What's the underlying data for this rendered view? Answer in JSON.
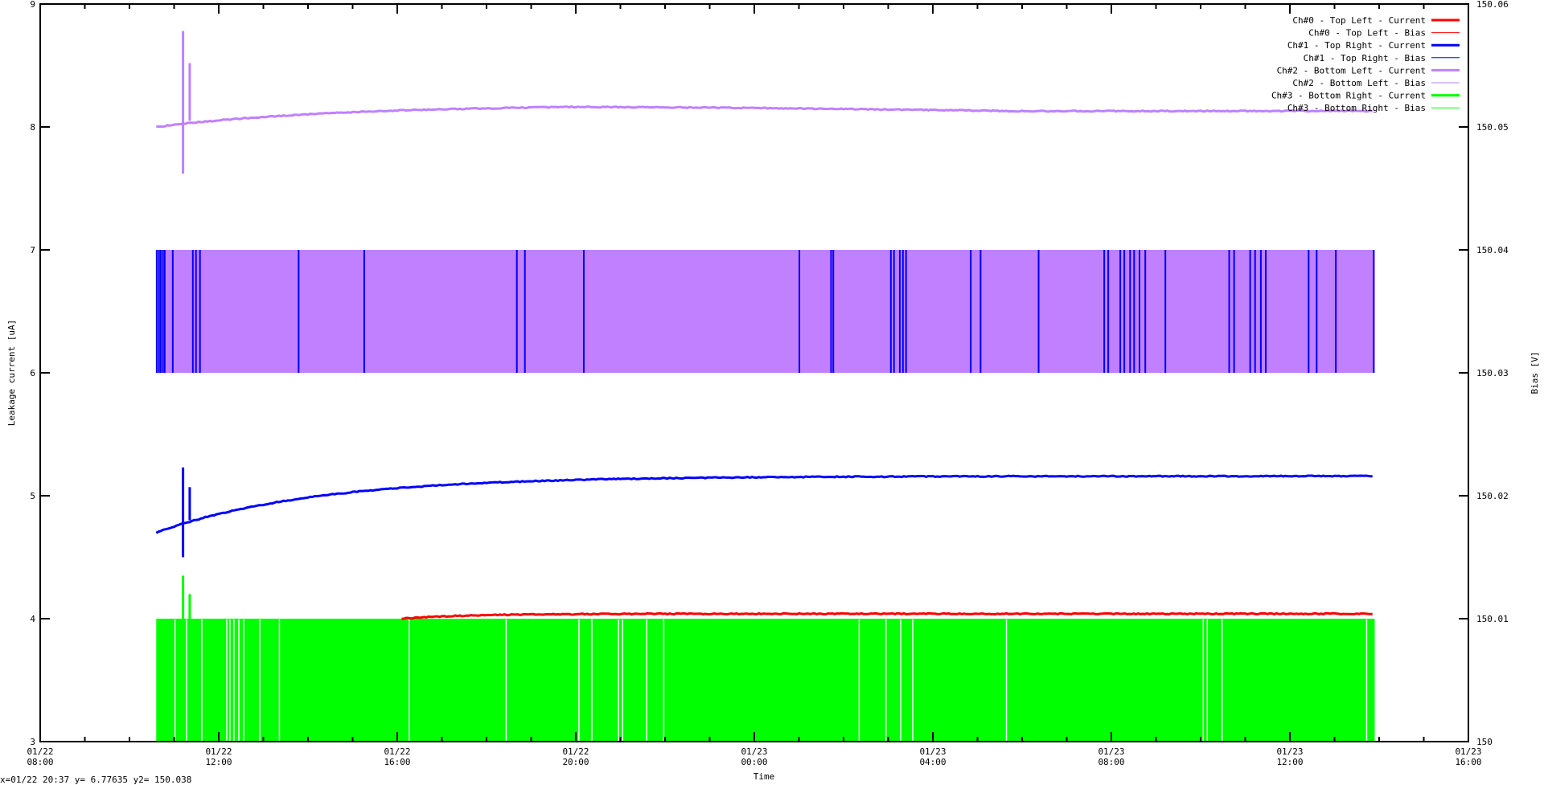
{
  "chart_data": {
    "type": "line",
    "title": "",
    "xlabel": "Time",
    "ylabel": "Leakage current [uA]",
    "y2label": "Bias [V]",
    "x_unit": "hours since 01/22 08:00",
    "xlim": [
      0,
      32
    ],
    "ylim": [
      3,
      9
    ],
    "y2lim": [
      150,
      150.06
    ],
    "grid": false,
    "legend_position": "top-right",
    "x_ticks": [
      {
        "h": 0,
        "label": [
          "01/22",
          "08:00"
        ]
      },
      {
        "h": 4,
        "label": [
          "01/22",
          "12:00"
        ]
      },
      {
        "h": 8,
        "label": [
          "01/22",
          "16:00"
        ]
      },
      {
        "h": 12,
        "label": [
          "01/22",
          "20:00"
        ]
      },
      {
        "h": 16,
        "label": [
          "01/23",
          "00:00"
        ]
      },
      {
        "h": 20,
        "label": [
          "01/23",
          "04:00"
        ]
      },
      {
        "h": 24,
        "label": [
          "01/23",
          "08:00"
        ]
      },
      {
        "h": 28,
        "label": [
          "01/23",
          "12:00"
        ]
      },
      {
        "h": 32,
        "label": [
          "01/23",
          "16:00"
        ]
      }
    ],
    "y_ticks": [
      "3",
      "4",
      "5",
      "6",
      "7",
      "8",
      "9"
    ],
    "y2_ticks": [
      "150",
      "150.01",
      "150.02",
      "150.03",
      "150.04",
      "150.05",
      "150.06"
    ],
    "data_range_hours": [
      2.6,
      29.9
    ],
    "series": [
      {
        "name": "Ch#0 - Top Left - Current",
        "color": "#ff0000",
        "axis": "y",
        "start": 8.1,
        "y0": 4.0,
        "y_end": 4.04,
        "tau": 1.5
      },
      {
        "name": "Ch#0 - Top Left - Bias",
        "color": "#ff0000",
        "axis": "y2"
      },
      {
        "name": "Ch#1 - Top Right - Current",
        "color": "#0000ff",
        "axis": "y",
        "start": 2.6,
        "y0": 4.7,
        "y_end": 5.16,
        "tau": 3.5,
        "spikes": [
          {
            "h": 3.2,
            "high": 5.23,
            "low": 4.5
          },
          {
            "h": 3.35,
            "high": 5.07,
            "low": 4.8
          }
        ]
      },
      {
        "name": "Ch#1 - Top Right - Bias",
        "color": "#0000ff",
        "axis": "y2",
        "band": [
          150.03,
          150.04
        ],
        "toggle_hours": [
          2.61,
          2.66,
          2.7,
          2.75,
          2.79,
          2.97,
          3.42,
          3.49,
          3.58,
          5.79,
          7.26,
          10.68,
          10.86,
          12.18,
          17.01,
          17.72,
          17.77,
          19.06,
          19.13,
          19.26,
          19.33,
          19.4,
          20.85,
          21.07,
          22.37,
          23.84,
          23.93,
          24.2,
          24.29,
          24.42,
          24.51,
          24.63,
          24.76,
          25.21,
          26.64,
          26.75,
          27.11,
          27.22,
          27.35,
          27.46,
          28.42,
          28.6,
          29.03,
          29.88
        ]
      },
      {
        "name": "Ch#2 - Bottom Left - Current",
        "color": "#c080ff",
        "axis": "y",
        "start": 2.6,
        "y0": 8.0,
        "y_peak": 8.18,
        "y_end": 8.13,
        "tau": 4,
        "spikes": [
          {
            "h": 3.2,
            "high": 8.78,
            "low": 7.62
          },
          {
            "h": 3.35,
            "high": 8.52,
            "low": 8.05
          }
        ]
      },
      {
        "name": "Ch#2 - Bottom Left - Bias",
        "color": "#c080ff",
        "axis": "y2",
        "band": [
          150.03,
          150.04
        ]
      },
      {
        "name": "Ch#3 - Bottom Right - Current",
        "color": "#00ff00",
        "axis": "y",
        "spikes": [
          {
            "h": 3.2,
            "high": 4.35,
            "low": 4.0
          },
          {
            "h": 3.35,
            "high": 4.2,
            "low": 4.0
          }
        ]
      },
      {
        "name": "Ch#3 - Bottom Right - Bias",
        "color": "#00ff00",
        "axis": "y2",
        "band": [
          150.0,
          150.01
        ],
        "gap_hours": [
          3.02,
          3.28,
          3.62,
          4.18,
          4.25,
          4.34,
          4.45,
          4.56,
          4.92,
          5.36,
          8.27,
          10.44,
          12.07,
          12.36,
          12.96,
          13.05,
          13.59,
          13.97,
          18.35,
          18.95,
          19.28,
          19.55,
          21.65,
          26.06,
          26.15,
          26.48,
          29.72
        ]
      }
    ]
  },
  "status": "x=01/22 20:37 y= 6.77635 y2= 150.038"
}
